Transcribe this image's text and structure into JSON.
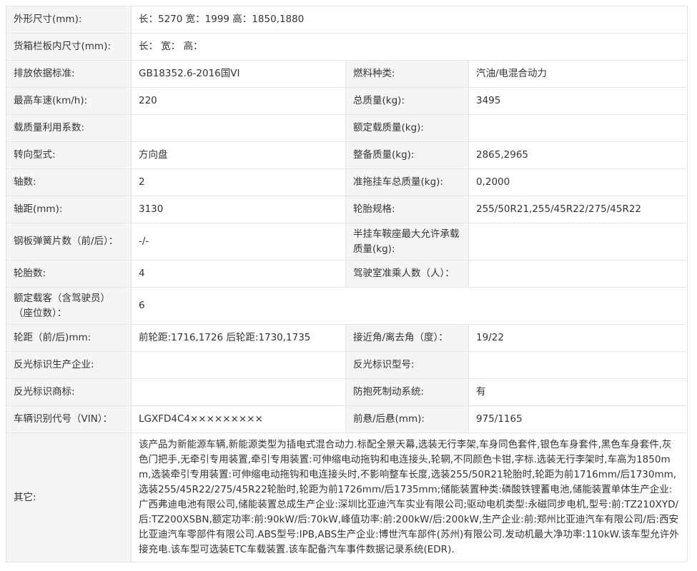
{
  "rows": [
    {
      "l1": "外形尺寸(mm):",
      "v1": "长：5270 宽：1999 高：1850,1880"
    },
    {
      "l1": "货箱栏板内尺寸(mm):",
      "v1": "长：  宽：  高："
    },
    {
      "l1": "排放依据标准:",
      "v1": "GB18352.6-2016国VI",
      "l2": "燃料种类:",
      "v2": "汽油/电混合动力"
    },
    {
      "l1": "最高车速(km/h):",
      "v1": "220",
      "l2": "总质量(kg):",
      "v2": "3495"
    },
    {
      "l1": "载质量利用系数:",
      "v1": "",
      "l2": "额定载质量(kg):",
      "v2": ""
    },
    {
      "l1": "转向型式:",
      "v1": "方向盘",
      "l2": "整备质量(kg):",
      "v2": "2865,2965"
    },
    {
      "l1": "轴数:",
      "v1": "2",
      "l2": "准拖挂车总质量(kg):",
      "v2": "0,2000"
    },
    {
      "l1": "轴距(mm):",
      "v1": "3130",
      "l2": "轮胎规格:",
      "v2": "255/50R21,255/45R22/275/45R22"
    },
    {
      "l1": "钢板弹簧片数（前/后）：",
      "v1": "-/-",
      "l2": "半挂车鞍座最大允许承载质量(kg):",
      "v2": ""
    },
    {
      "l1": "轮胎数:",
      "v1": "4",
      "l2": "驾驶室准乘人数（人）：",
      "v2": ""
    },
    {
      "l1": "额定载客（含驾驶员）（座位数）：",
      "v1": "6"
    },
    {
      "l1": "轮距（前/后)mm:",
      "v1": "前轮距:1716,1726 后轮距:1730,1735",
      "l2": "接近角/离去角（度）：",
      "v2": "19/22"
    },
    {
      "l1": "反光标识生产企业:",
      "v1": "",
      "l2": "反光标识型号:",
      "v2": ""
    },
    {
      "l1": "反光标识商标:",
      "v1": "",
      "l2": "防抱死制动系统:",
      "v2": "有"
    },
    {
      "l1": "车辆识别代号（VIN）：",
      "v1": "LGXFD4C4×××××××××",
      "l2": "前悬/后悬(mm):",
      "v2": "975/1165"
    },
    {
      "l1": "其它:",
      "v1": "该产品为新能源车辆,新能源类型为插电式混合动力.标配全景天幕,选装无行李架,车身同色套件,银色车身套件,黑色车身套件,灰色门把手,无牵引专用装置,牵引专用装置:可伸缩电动拖钩和电连接头,轮辋,不同颜色卡钳,字标.选装无行李架时,车高为1850mm,选装牵引专用装置:可伸缩电动拖钩和电连接头时,不影响整车长度,选装255/50R21轮胎时,轮距为前1716mm/后1730mm,选装255/45R22/275/45R22轮胎时,轮距为前1726mm/后1735mm;储能装置种类:磷酸铁锂蓄电池,储能装置单体生产企业:广西弗迪电池有限公司,储能装置总成生产企业:深圳比亚迪汽车实业有限公司;驱动电机类型:永磁同步电机,型号:前:TZ210XYD/后:TZ200XSBN,额定功率:前:90kW/后:70kW,峰值功率:前:200kW/后:200kW,生产企业:前:郑州比亚迪汽车有限公司/后:西安比亚迪汽车零部件有限公司.ABS型号:IPB,ABS生产企业:博世汽车部件(苏州)有限公司.发动机最大净功率:110kW.该车型允许外接充电.该车型可选装ETC车载装置.该车配备汽车事件数据记录系统(EDR)."
    }
  ]
}
